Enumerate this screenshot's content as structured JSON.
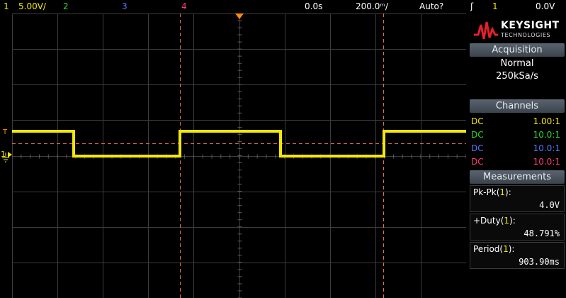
{
  "topbar": {
    "ch1_num": "1",
    "ch1_scale": "5.00V/",
    "ch2_num": "2",
    "ch3_num": "3",
    "ch4_num": "4",
    "delay": "0.0s",
    "timebase": "200.0ᵐ/",
    "trigger_mode": "Auto?",
    "trigger_slope": "ʃ",
    "trigger_source": "1",
    "trigger_level": "0.0V"
  },
  "logo": {
    "brand": "KEYSIGHT",
    "sub": "TECHNOLOGIES"
  },
  "acquisition": {
    "header": "Acquisition",
    "mode": "Normal",
    "rate": "250kSa/s"
  },
  "channels": {
    "header": "Channels",
    "rows": [
      {
        "coupling": "DC",
        "probe": "1.00:1",
        "color": "#f4e800"
      },
      {
        "coupling": "DC",
        "probe": "10.0:1",
        "color": "#2bd62b"
      },
      {
        "coupling": "DC",
        "probe": "10.0:1",
        "color": "#5a76ff"
      },
      {
        "coupling": "DC",
        "probe": "10.0:1",
        "color": "#ff3a7a"
      }
    ]
  },
  "measurements": {
    "header": "Measurements",
    "items": [
      {
        "name": "Pk-Pk",
        "src": "1",
        "value": "4.0V"
      },
      {
        "name": "+Duty",
        "src": "1",
        "value": "48.791%"
      },
      {
        "name": "Period",
        "src": "1",
        "value": "903.90ms"
      }
    ]
  },
  "markers": {
    "trigger_level_label": "T",
    "ch1_ground_label": "1"
  },
  "colors": {
    "ch1": "#f4e800",
    "ch2": "#2bd62b",
    "ch3": "#5a76ff",
    "ch4": "#ff3a7a",
    "grid": "#3c3c3c",
    "cursor": "#e07050",
    "trigger_marker": "#ff8c00"
  },
  "waveform": {
    "signal": "square",
    "high_level": "HIGH",
    "low_level": "LOW"
  }
}
